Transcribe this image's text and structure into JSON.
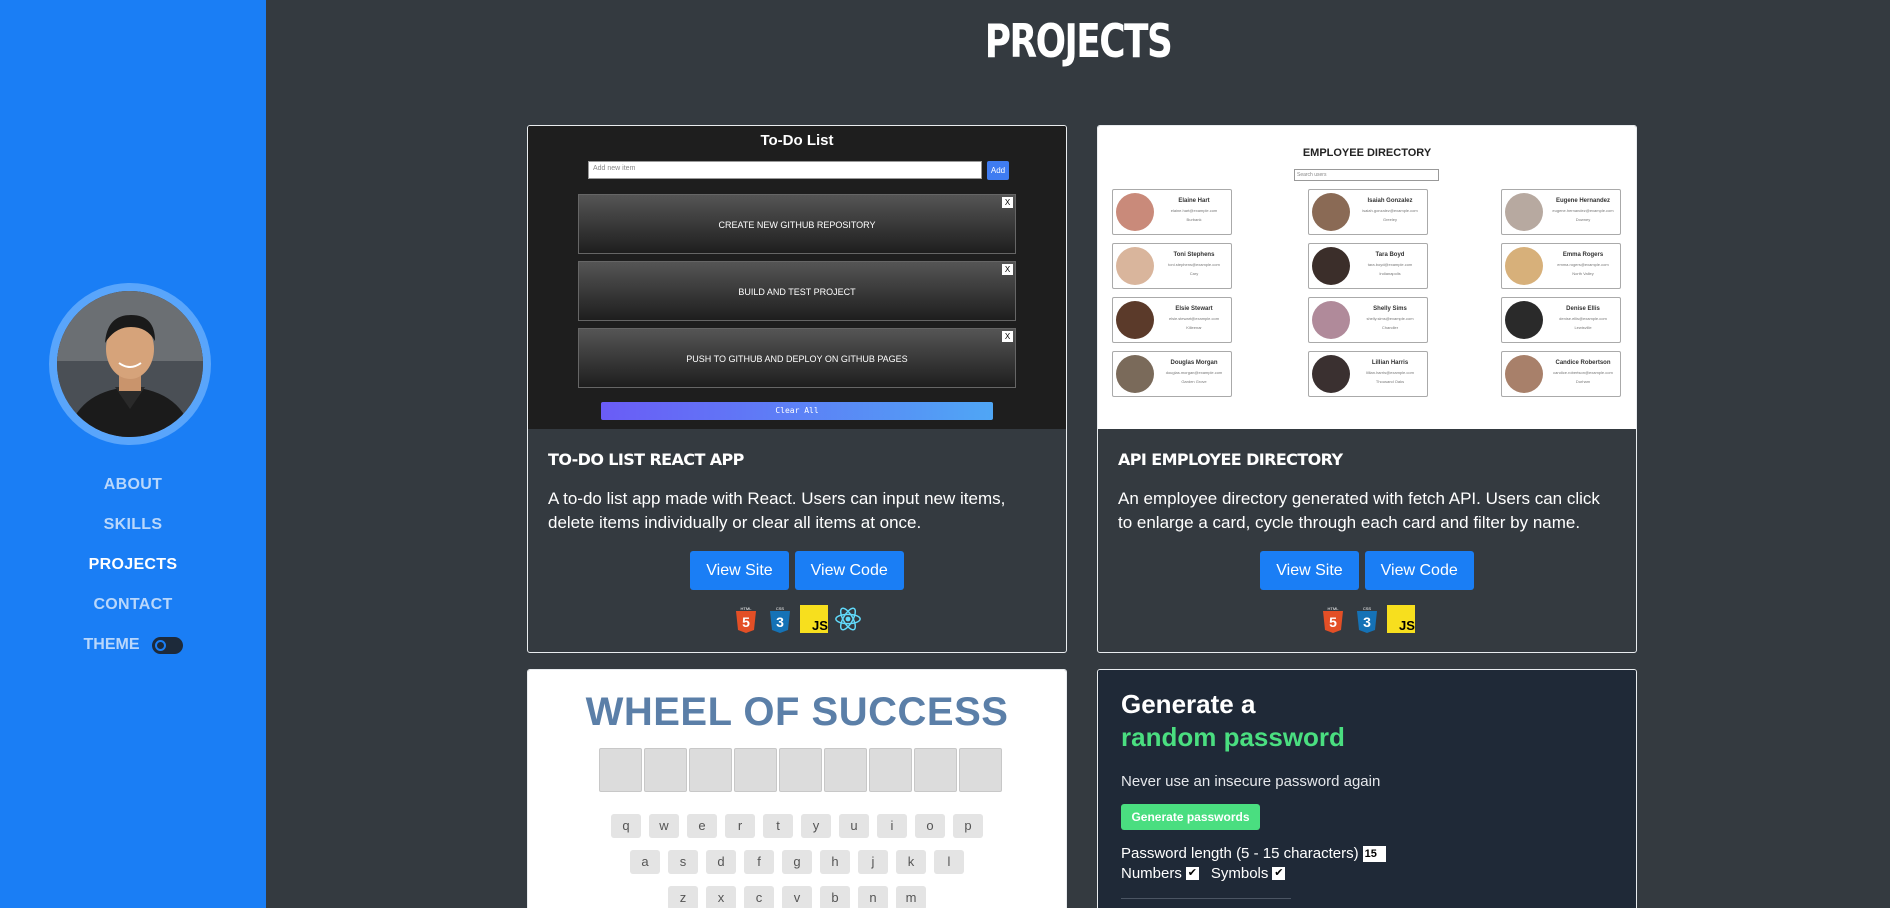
{
  "sidebar": {
    "nav": [
      {
        "label": "ABOUT",
        "active": false
      },
      {
        "label": "SKILLS",
        "active": false
      },
      {
        "label": "PROJECTS",
        "active": true
      },
      {
        "label": "CONTACT",
        "active": false
      }
    ],
    "theme_label": "THEME",
    "theme_toggle_on": false
  },
  "page_title": "PROJECTS",
  "projects": [
    {
      "title": "TO-DO LIST REACT APP",
      "description": "A to-do list app made with React. Users can input new items, delete items individually or clear all items at once.",
      "view_site": "View Site",
      "view_code": "View Code",
      "tech_icons": [
        "html5-icon",
        "css3-icon",
        "javascript-icon",
        "react-icon"
      ],
      "screenshot": {
        "heading": "To-Do List",
        "input_placeholder": "Add new item",
        "add_label": "Add",
        "items": [
          "CREATE NEW GITHUB REPOSITORY",
          "BUILD AND TEST PROJECT",
          "PUSH TO GITHUB AND DEPLOY ON GITHUB PAGES"
        ],
        "delete_label": "X",
        "clear_label": "Clear All"
      }
    },
    {
      "title": "API EMPLOYEE DIRECTORY",
      "description": "An employee directory generated with fetch API. Users can click to enlarge a card, cycle through each card and filter by name.",
      "view_site": "View Site",
      "view_code": "View Code",
      "tech_icons": [
        "html5-icon",
        "css3-icon",
        "javascript-icon"
      ],
      "screenshot": {
        "heading": "EMPLOYEE DIRECTORY",
        "search_placeholder": "Search users",
        "employees": [
          {
            "name": "Elaine Hart",
            "email": "elaine.hart@example.com",
            "city": "Burbank"
          },
          {
            "name": "Isaiah Gonzalez",
            "email": "isaiah.gonzalez@example.com",
            "city": "Greeley"
          },
          {
            "name": "Eugene Hernandez",
            "email": "eugene.hernandez@example.com",
            "city": "Downey"
          },
          {
            "name": "Toni Stephens",
            "email": "toni.stephens@example.com",
            "city": "Cary"
          },
          {
            "name": "Tara Boyd",
            "email": "tara.boyd@example.com",
            "city": "Indianapolis"
          },
          {
            "name": "Emma Rogers",
            "email": "emma.rogers@example.com",
            "city": "North Valley"
          },
          {
            "name": "Elsie Stewart",
            "email": "elsie.stewart@example.com",
            "city": "Killeenar"
          },
          {
            "name": "Shelly Sims",
            "email": "shelly.sims@example.com",
            "city": "Chandler"
          },
          {
            "name": "Denise Ellis",
            "email": "denise.ellis@example.com",
            "city": "Lewisville"
          },
          {
            "name": "Douglas Morgan",
            "email": "douglas.morgan@example.com",
            "city": "Garden Grove"
          },
          {
            "name": "Lillian Harris",
            "email": "lillian.harris@example.com",
            "city": "Thousand Oaks"
          },
          {
            "name": "Candice Robertson",
            "email": "candice.robertson@example.com",
            "city": "Durham"
          }
        ]
      }
    },
    {
      "screenshot": {
        "heading": "WHEEL OF SUCCESS",
        "letter_slots": 9,
        "key_rows": [
          [
            "q",
            "w",
            "e",
            "r",
            "t",
            "y",
            "u",
            "i",
            "o",
            "p"
          ],
          [
            "a",
            "s",
            "d",
            "f",
            "g",
            "h",
            "j",
            "k",
            "l"
          ],
          [
            "z",
            "x",
            "c",
            "v",
            "b",
            "n",
            "m"
          ]
        ]
      }
    },
    {
      "screenshot": {
        "heading_line1": "Generate a",
        "heading_line2": "random password",
        "subtitle": "Never use an insecure password again",
        "button_label": "Generate passwords",
        "length_label": "Password length (5 - 15 characters)",
        "length_value": "15",
        "numbers_label": "Numbers",
        "symbols_label": "Symbols",
        "numbers_checked": true,
        "symbols_checked": true
      }
    }
  ],
  "colors": {
    "sidebar": "#1a7ef5",
    "background": "#343a40",
    "button": "#1a7ef5",
    "html5": "#e34f26",
    "css3": "#1572b6",
    "javascript": "#f7df1e",
    "react": "#61dafb"
  }
}
